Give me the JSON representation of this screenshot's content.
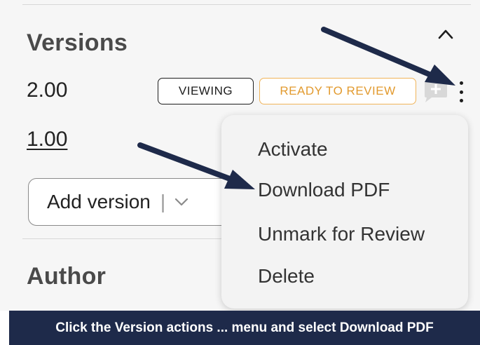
{
  "panel": {
    "versions_title": "Versions",
    "author_title": "Author",
    "versions": [
      {
        "number": "2.00",
        "badges": [
          "VIEWING",
          "READY TO REVIEW"
        ]
      },
      {
        "number": "1.00"
      }
    ],
    "add_version_label": "Add version",
    "add_version_separator": "|"
  },
  "version_actions_menu": {
    "items": [
      {
        "label": "Activate"
      },
      {
        "label": "Download PDF"
      },
      {
        "label": "Unmark for Review"
      },
      {
        "label": "Delete"
      }
    ]
  },
  "instruction": "Click the Version actions ... menu and select Download PDF",
  "colors": {
    "panel_bg": "#f6f6f6",
    "ready_badge": "#e29a2e",
    "annotation_arrow": "#1e2a4a",
    "footer_bg": "#1e2a4a"
  },
  "icons": [
    "chevron-up-icon",
    "comment-add-icon",
    "kebab-menu-icon",
    "chevron-down-icon"
  ]
}
